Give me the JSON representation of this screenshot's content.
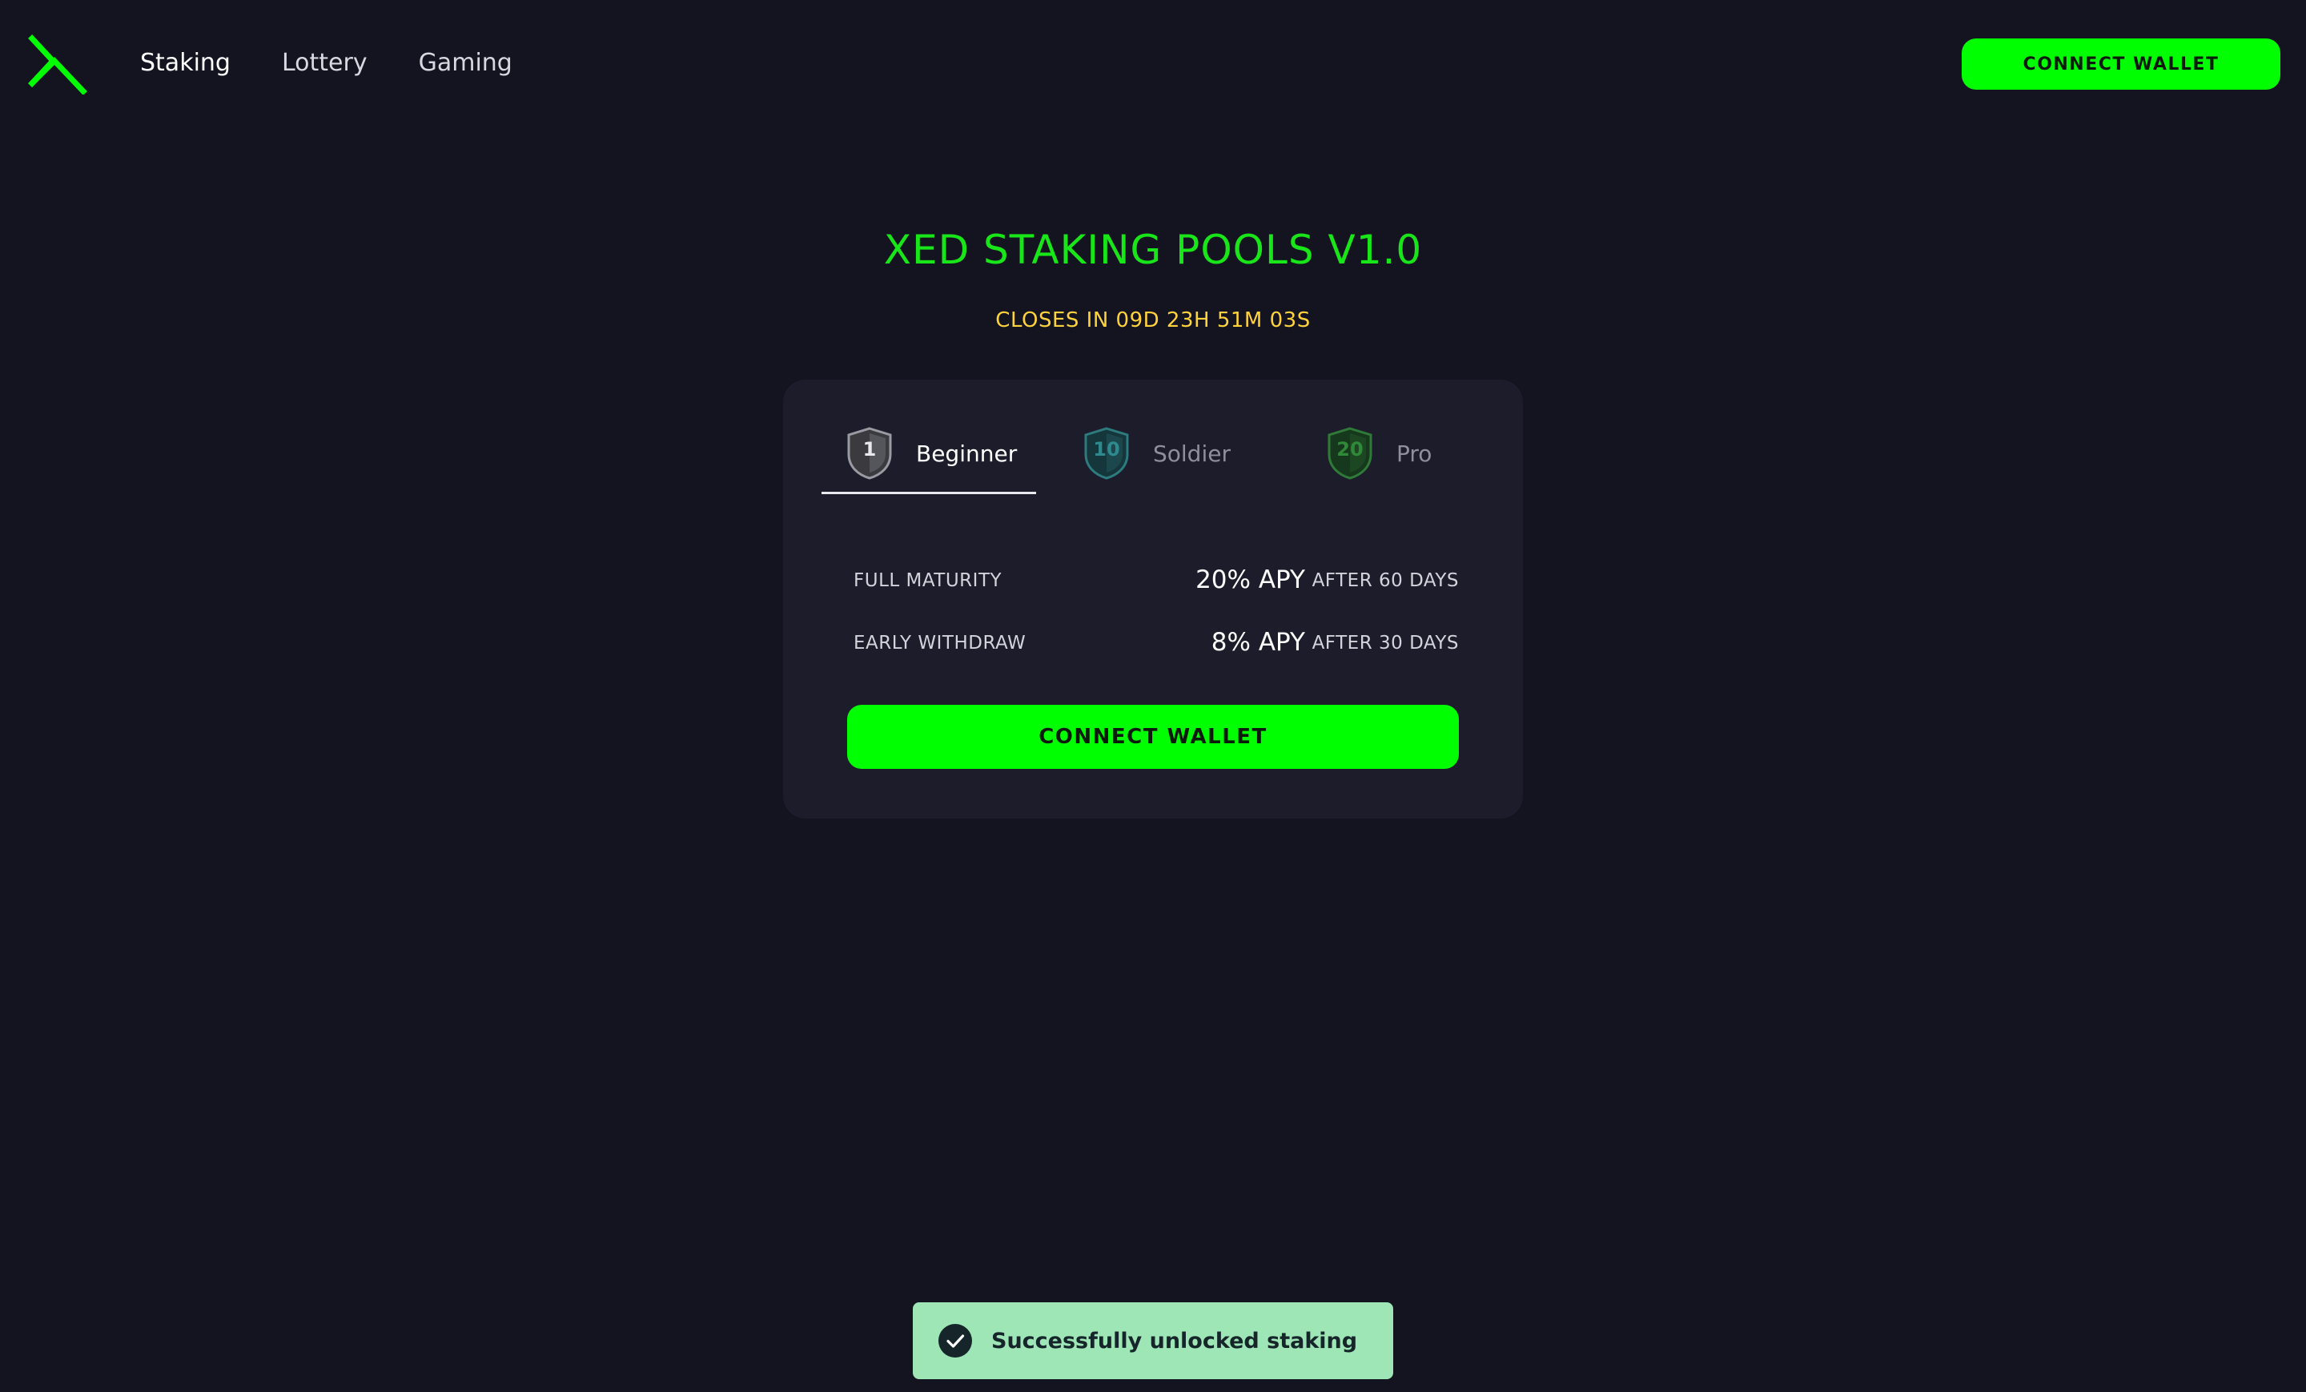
{
  "nav": {
    "items": [
      {
        "label": "Staking",
        "active": true
      },
      {
        "label": "Lottery",
        "active": false
      },
      {
        "label": "Gaming",
        "active": false
      }
    ],
    "connect_label": "CONNECT WALLET"
  },
  "colors": {
    "background": "#141420",
    "card": "#1c1c2a",
    "accent": "#00ff00",
    "title": "#19e619",
    "countdown": "#ffd23c",
    "toast": "#9ee6b6"
  },
  "title": "XED STAKING POOLS V1.0",
  "countdown": "CLOSES IN 09D 23H 51M 03S",
  "tabs": [
    {
      "number": "1",
      "label": "Beginner",
      "active": true,
      "icon": "shield-silver-icon"
    },
    {
      "number": "10",
      "label": "Soldier",
      "active": false,
      "icon": "shield-teal-icon"
    },
    {
      "number": "20",
      "label": "Pro",
      "active": false,
      "icon": "shield-green-icon"
    }
  ],
  "rates": [
    {
      "label": "FULL MATURITY",
      "apy": "20% APY",
      "after": "AFTER 60 DAYS"
    },
    {
      "label": "EARLY WITHDRAW",
      "apy": "8% APY",
      "after": "AFTER 30 DAYS"
    }
  ],
  "card_connect_label": "CONNECT WALLET",
  "toast": {
    "icon": "check-circle-icon",
    "message": "Successfully unlocked staking"
  }
}
